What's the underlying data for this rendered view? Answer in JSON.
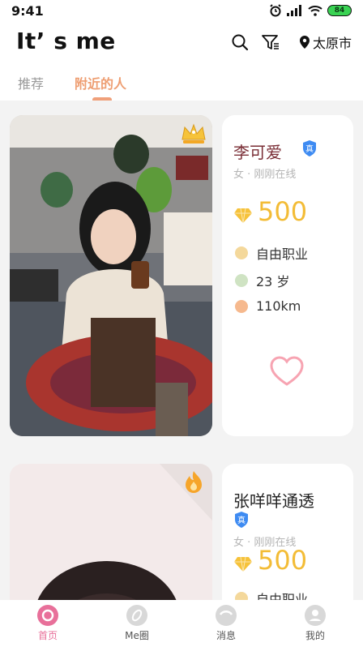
{
  "status_bar": {
    "time": "9:41",
    "battery": "84"
  },
  "header": {
    "app_title": "It’ s me",
    "city": "太原市"
  },
  "tabs": [
    {
      "label": "推荐",
      "active": false
    },
    {
      "label": "附近的人",
      "active": true
    }
  ],
  "cards": [
    {
      "name": "李可爱",
      "verified_badge": "真",
      "status": "女 · 刚刚在线",
      "coins": "500",
      "occupation": "自由职业",
      "age": "23 岁",
      "distance": "110km"
    },
    {
      "name": "张咩咩通透",
      "verified_badge": "真",
      "status": "女 · 刚刚在线",
      "coins": "500",
      "occupation": "自由职业"
    }
  ],
  "bottom_nav": [
    {
      "label": "首页",
      "active": true
    },
    {
      "label": "Me圈",
      "active": false
    },
    {
      "label": "消息",
      "active": false
    },
    {
      "label": "我的",
      "active": false
    }
  ],
  "colors": {
    "accent": "#ef9f72",
    "gold": "#f3bc36",
    "active_nav": "#e8709a",
    "name": "#7a2e36"
  }
}
